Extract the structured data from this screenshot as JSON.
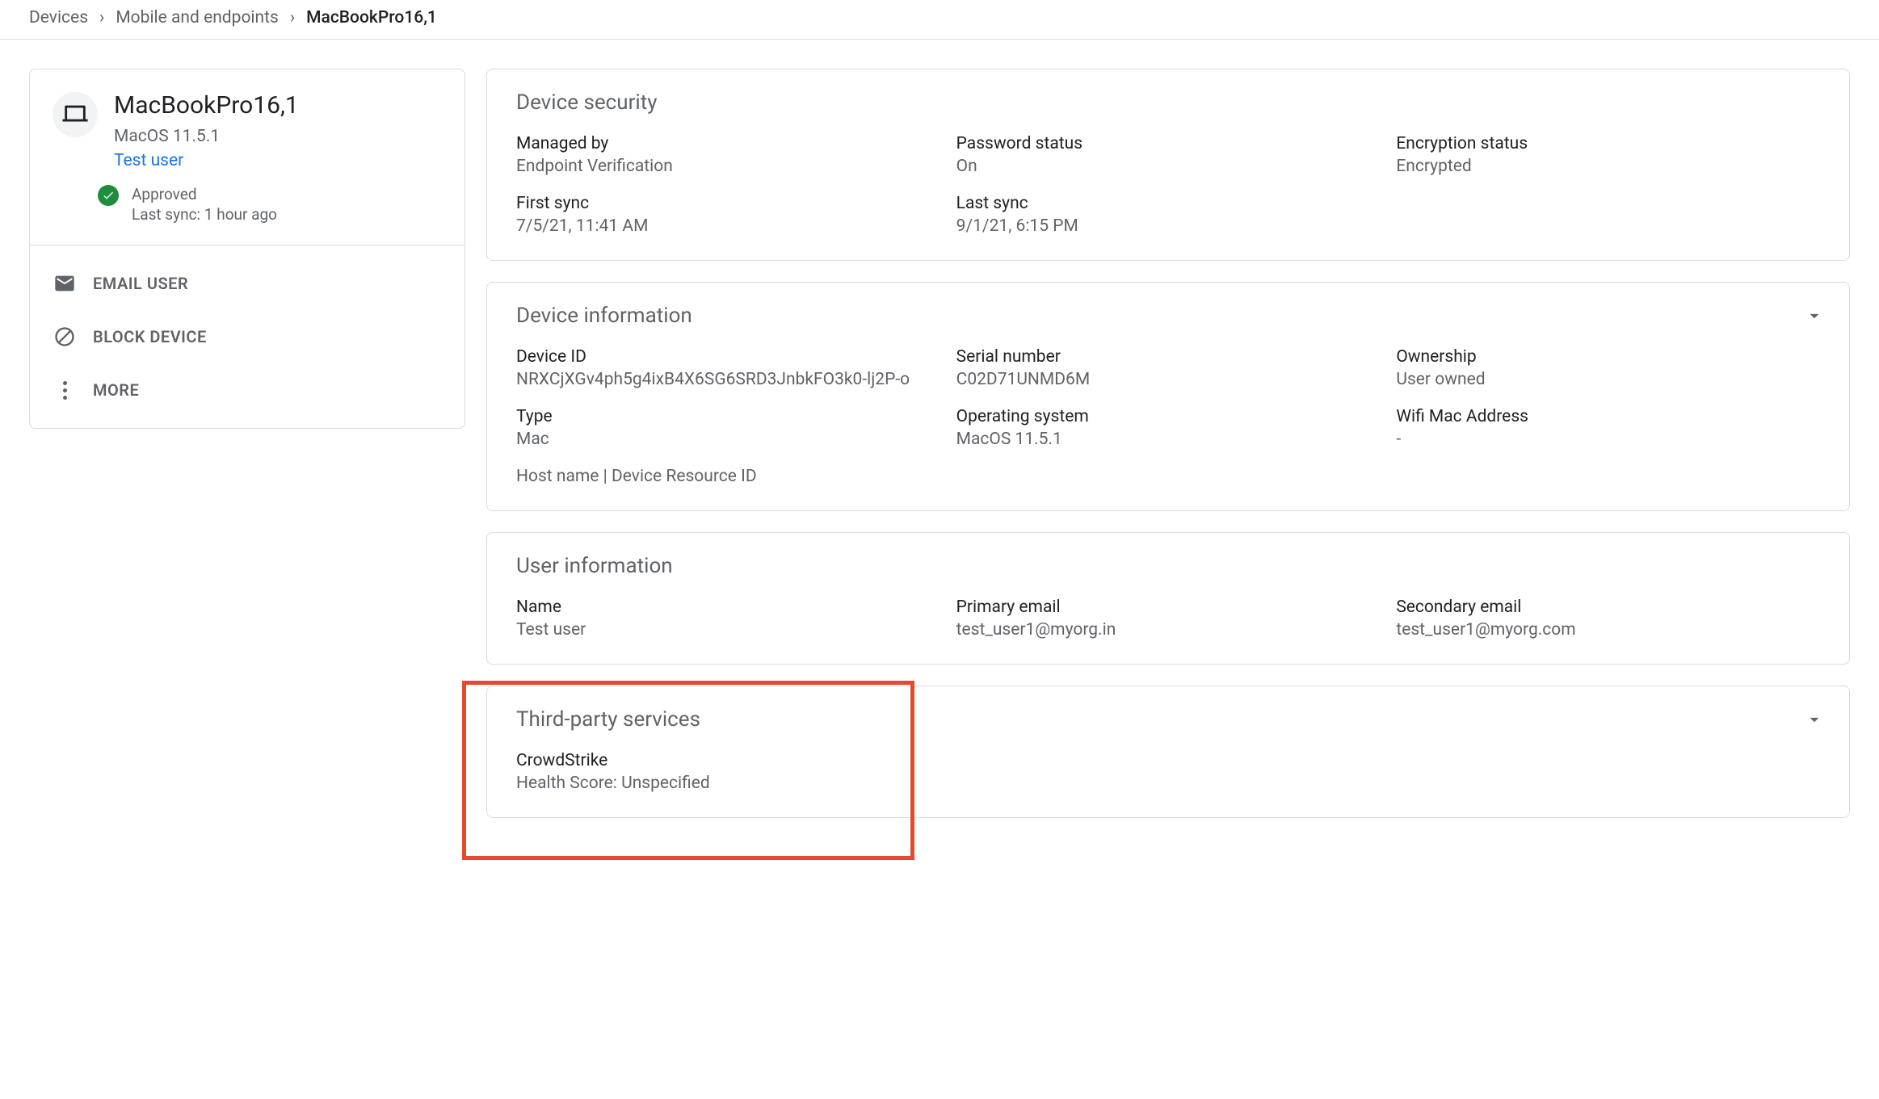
{
  "breadcrumbs": {
    "a": "Devices",
    "b": "Mobile and endpoints",
    "c": "MacBookPro16,1"
  },
  "device": {
    "name": "MacBookPro16,1",
    "os": "MacOS 11.5.1",
    "user": "Test user",
    "status": "Approved",
    "sync": "Last sync: 1 hour ago"
  },
  "actions": {
    "email": "EMAIL USER",
    "block": "BLOCK DEVICE",
    "more": "MORE"
  },
  "security": {
    "title": "Device security",
    "managed_by": {
      "lab": "Managed by",
      "val": "Endpoint Verification"
    },
    "password": {
      "lab": "Password status",
      "val": "On"
    },
    "encryption": {
      "lab": "Encryption status",
      "val": "Encrypted"
    },
    "first_sync": {
      "lab": "First sync",
      "val": "7/5/21, 11:41 AM"
    },
    "last_sync": {
      "lab": "Last sync",
      "val": "9/1/21, 6:15 PM"
    }
  },
  "info": {
    "title": "Device information",
    "device_id": {
      "lab": "Device ID",
      "val": "NRXCjXGv4ph5g4ixB4X6SG6SRD3JnbkFO3k0-lj2P-o"
    },
    "serial": {
      "lab": "Serial number",
      "val": "C02D71UNMD6M"
    },
    "ownership": {
      "lab": "Ownership",
      "val": "User owned"
    },
    "type": {
      "lab": "Type",
      "val": "Mac"
    },
    "os": {
      "lab": "Operating system",
      "val": "MacOS 11.5.1"
    },
    "wifi": {
      "lab": "Wifi Mac Address",
      "val": "-"
    },
    "footer": "Host name | Device Resource ID"
  },
  "user": {
    "title": "User information",
    "name": {
      "lab": "Name",
      "val": "Test user"
    },
    "pem": {
      "lab": "Primary email",
      "val": "test_user1@myorg.in"
    },
    "sem": {
      "lab": "Secondary email",
      "val": "test_user1@myorg.com"
    }
  },
  "tps": {
    "title": "Third-party services",
    "cs": {
      "lab": "CrowdStrike",
      "val": "Health Score: Unspecified"
    }
  }
}
